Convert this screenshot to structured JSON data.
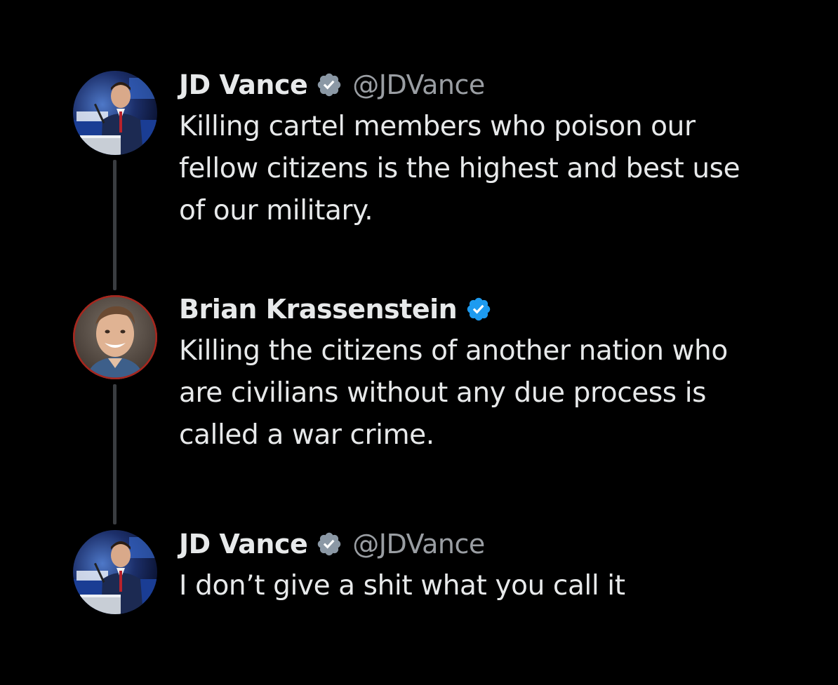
{
  "colors": {
    "background": "#000000",
    "text": "#e7e9ea",
    "handle": "#9a9ea3",
    "thread_line": "#3a3d41",
    "badge_gray": "#8b98a5",
    "badge_blue": "#1d9bf0"
  },
  "tweets": [
    {
      "name": "JD Vance",
      "badge_icon": "verified-gray-badge",
      "handle": "@JDVance",
      "text": "Killing cartel members who poison our\nfellow citizens is the highest and best use\nof our military."
    },
    {
      "name": "Brian Krassenstein",
      "badge_icon": "verified-blue-badge",
      "handle": "",
      "text": "Killing the citizens of another nation who\nare civilians without any due process is\ncalled a war crime."
    },
    {
      "name": "JD Vance",
      "badge_icon": "verified-gray-badge",
      "handle": "@JDVance",
      "text": "I don’t give a shit what you call it"
    }
  ]
}
